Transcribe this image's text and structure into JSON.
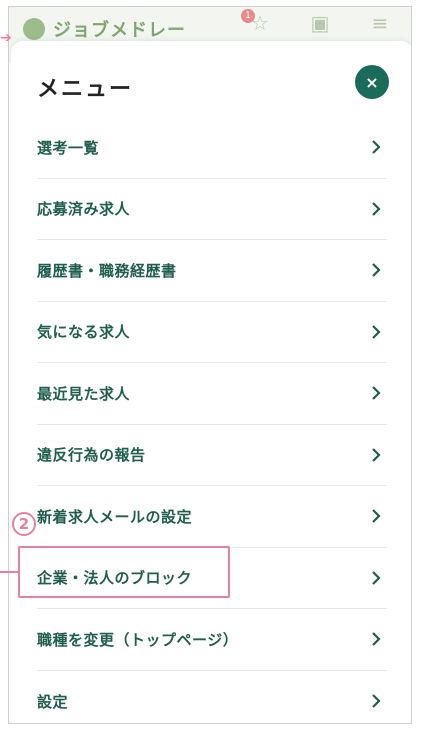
{
  "background": {
    "logo_text": "ジョブメドレー",
    "badge_count": "1"
  },
  "menu": {
    "title": "メニュー",
    "close_icon": "×",
    "items": [
      {
        "label": "選考一覧"
      },
      {
        "label": "応募済み求人"
      },
      {
        "label": "履歴書・職務経歴書"
      },
      {
        "label": "気になる求人"
      },
      {
        "label": "最近見た求人"
      },
      {
        "label": "違反行為の報告"
      },
      {
        "label": "新着求人メールの設定"
      },
      {
        "label": "企業・法人のブロック"
      },
      {
        "label": "職種を変更（トップページ）"
      },
      {
        "label": "設定"
      }
    ]
  },
  "annotation": {
    "number": "2",
    "color": "#e87ea0"
  },
  "colors": {
    "accent": "#1b6b5a",
    "label": "#1f5d4e"
  }
}
